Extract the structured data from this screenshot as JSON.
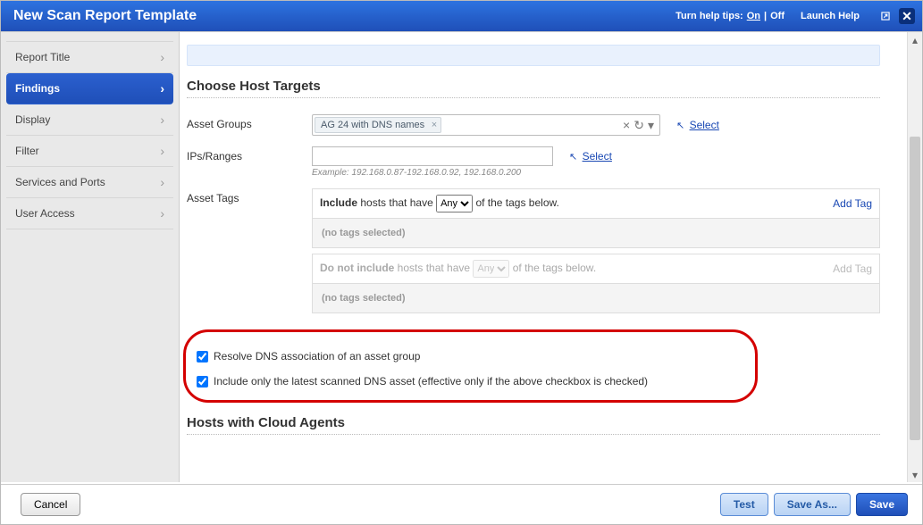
{
  "titlebar": {
    "title": "New Scan Report Template",
    "tips_label": "Turn help tips:",
    "tips_on": "On",
    "tips_sep": "|",
    "tips_off": "Off",
    "launch_help": "Launch Help"
  },
  "sidebar": {
    "items": [
      {
        "label": "Report Title"
      },
      {
        "label": "Findings"
      },
      {
        "label": "Display"
      },
      {
        "label": "Filter"
      },
      {
        "label": "Services and Ports"
      },
      {
        "label": "User Access"
      }
    ]
  },
  "main": {
    "section_title": "Choose Host Targets",
    "asset_groups_label": "Asset Groups",
    "asset_groups_token": "AG 24 with DNS names",
    "select_link": "Select",
    "ips_label": "IPs/Ranges",
    "ips_value": "",
    "example_prefix": "Example:",
    "example_text": "192.168.0.87-192.168.0.92, 192.168.0.200",
    "asset_tags_label": "Asset Tags",
    "include_prefix": "Include",
    "include_middle": "hosts that have",
    "include_suffix": "of the tags below.",
    "include_selector": "Any",
    "add_tag": "Add Tag",
    "no_tags": "(no tags selected)",
    "exclude_prefix": "Do not include",
    "exclude_middle": "hosts that have",
    "exclude_suffix": "of the tags below.",
    "exclude_selector": "Any",
    "check1": "Resolve DNS association of an asset group",
    "check2": "Include only the latest scanned DNS asset (effective only if the above checkbox is checked)",
    "hosts_cloud_title": "Hosts with Cloud Agents"
  },
  "footer": {
    "cancel": "Cancel",
    "test": "Test",
    "saveas": "Save As...",
    "save": "Save"
  }
}
